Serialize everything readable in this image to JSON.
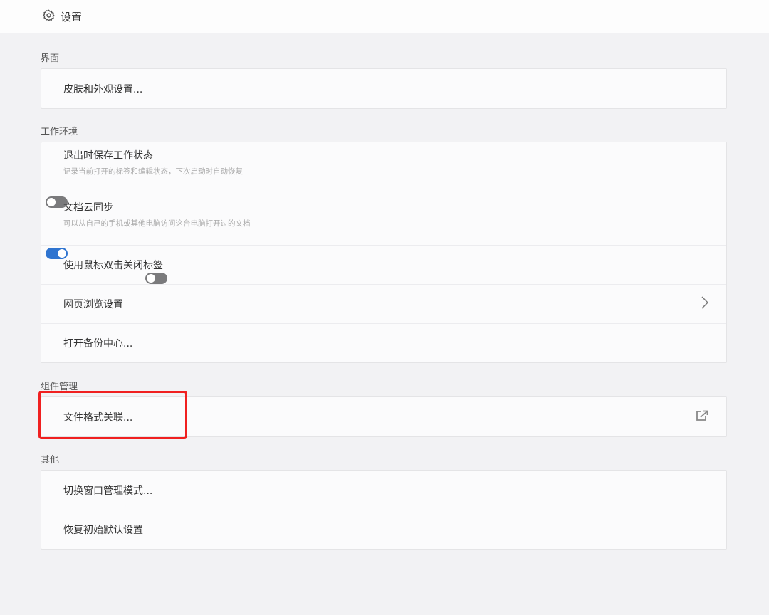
{
  "header": {
    "title": "设置",
    "icon": "gear-icon"
  },
  "sections": [
    {
      "label": "界面",
      "items": [
        {
          "label": "皮肤和外观设置..."
        }
      ]
    },
    {
      "label": "工作环境",
      "items": [
        {
          "label": "退出时保存工作状态",
          "desc": "记录当前打开的标签和编辑状态，下次启动时自动恢复",
          "toggle": false
        },
        {
          "label": "文档云同步",
          "desc": "可以从自己的手机或其他电脑访问这台电脑打开过的文档",
          "toggle": true
        },
        {
          "label": "使用鼠标双击关闭标签",
          "toggle": false
        },
        {
          "label": "网页浏览设置",
          "icon": "chevron-right-icon"
        },
        {
          "label": "打开备份中心..."
        }
      ]
    },
    {
      "label": "组件管理",
      "items": [
        {
          "label": "文件格式关联...",
          "icon": "external-link-icon"
        }
      ]
    },
    {
      "label": "其他",
      "items": [
        {
          "label": "切换窗口管理模式..."
        },
        {
          "label": "恢复初始默认设置"
        }
      ]
    }
  ],
  "colors": {
    "accent": "#2f74d0",
    "highlight": "#f02020"
  }
}
